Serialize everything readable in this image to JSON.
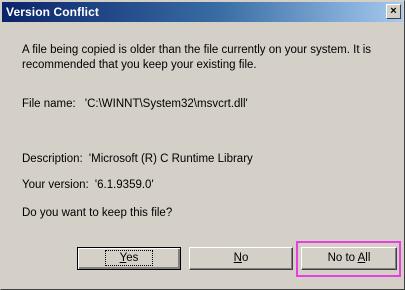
{
  "window": {
    "title": "Version Conflict",
    "close_glyph": "×"
  },
  "message": "A file being copied is older than the file currently on your system.  It is recommended that you keep your existing file.",
  "file": {
    "label": "File name:",
    "value": "'C:\\WINNT\\System32\\msvcrt.dll'"
  },
  "description": {
    "label": "Description:",
    "value": "'Microsoft (R) C Runtime Library"
  },
  "version": {
    "label": "Your version:",
    "value": "'6.1.9359.0'"
  },
  "question": "Do you want to keep this file?",
  "buttons": {
    "yes": {
      "accel": "Y",
      "rest": "es"
    },
    "no": {
      "accel": "N",
      "rest": "o"
    },
    "no_to_all": {
      "prefix": "No to ",
      "accel": "A",
      "rest": "ll"
    }
  },
  "highlight_color": "#e840e0"
}
